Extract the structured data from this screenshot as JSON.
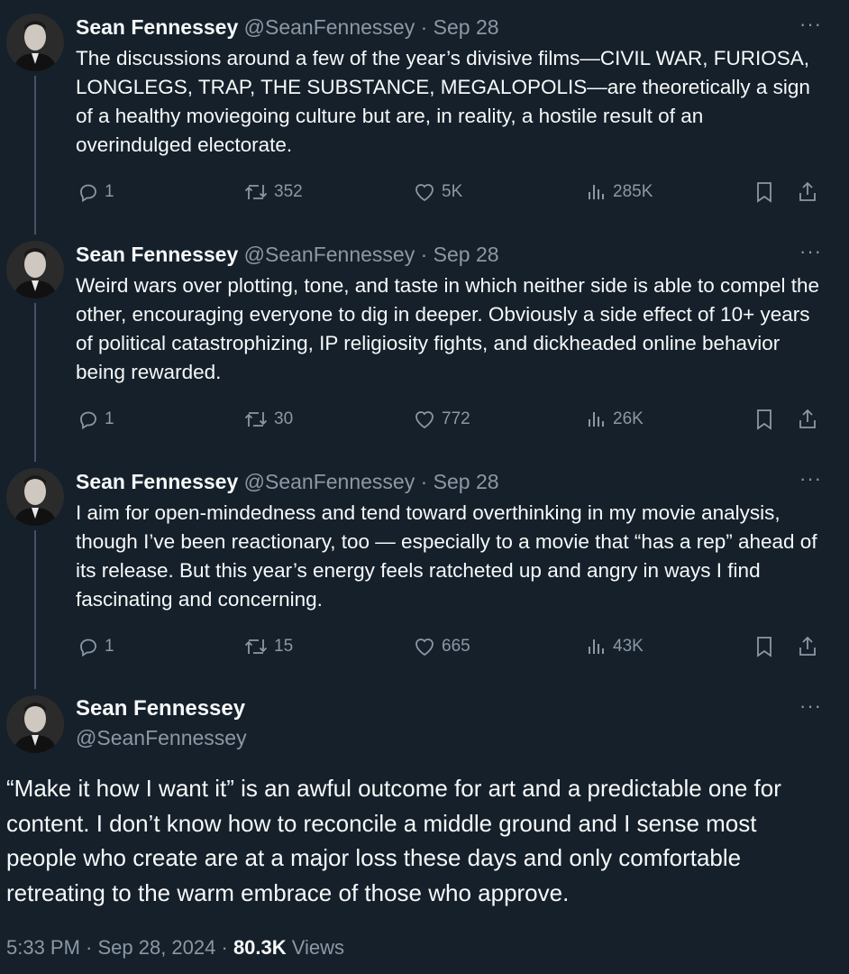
{
  "author": {
    "name": "Sean Fennessey",
    "handle": "@SeanFennessey"
  },
  "more_glyph": "···",
  "replies": [
    {
      "header_meta": "@SeanFennessey · Sep 28",
      "text": "The discussions around a few of the year’s divisive films—CIVIL WAR, FURIOSA, LONGLEGS, TRAP, THE SUBSTANCE, MEGALOPOLIS—are theoretically a sign of a healthy moviegoing culture but are, in reality, a hostile result of an overindulged electorate.",
      "replies": "1",
      "reposts": "352",
      "likes": "5K",
      "views": "285K"
    },
    {
      "header_meta": "@SeanFennessey · Sep 28",
      "text": "Weird wars over plotting, tone, and taste in which neither side is able to compel the other, encouraging everyone to dig in deeper. Obviously a side effect of 10+ years of political catastrophizing, IP religiosity fights, and dickheaded online behavior being rewarded.",
      "replies": "1",
      "reposts": "30",
      "likes": "772",
      "views": "26K"
    },
    {
      "header_meta": "@SeanFennessey · Sep 28",
      "text": "I aim for open-mindedness and tend toward overthinking in my movie analysis, though I’ve been reactionary, too — especially to a movie that “has a rep” ahead of its release. But this year’s energy feels ratcheted up and angry in ways I find fascinating and concerning.",
      "replies": "1",
      "reposts": "15",
      "likes": "665",
      "views": "43K"
    }
  ],
  "main_tweet": {
    "text": "“Make it how I want it” is an awful outcome for art and a predictable one for content. I don’t know how to reconcile a middle ground and I sense most people who create are at a major loss these days and only comfortable retreating to the warm embrace of those who approve.",
    "timestamp": "5:33 PM · Sep 28, 2024 · ",
    "views_count": "80.3K",
    "views_label": " Views"
  },
  "colors": {
    "background": "#15202b",
    "text": "#f7f9f9",
    "muted": "#8b98a5",
    "thread_line": "#425364"
  },
  "icons": [
    "reply-icon",
    "repost-icon",
    "like-icon",
    "views-icon",
    "bookmark-icon",
    "share-icon",
    "more-icon",
    "avatar"
  ]
}
